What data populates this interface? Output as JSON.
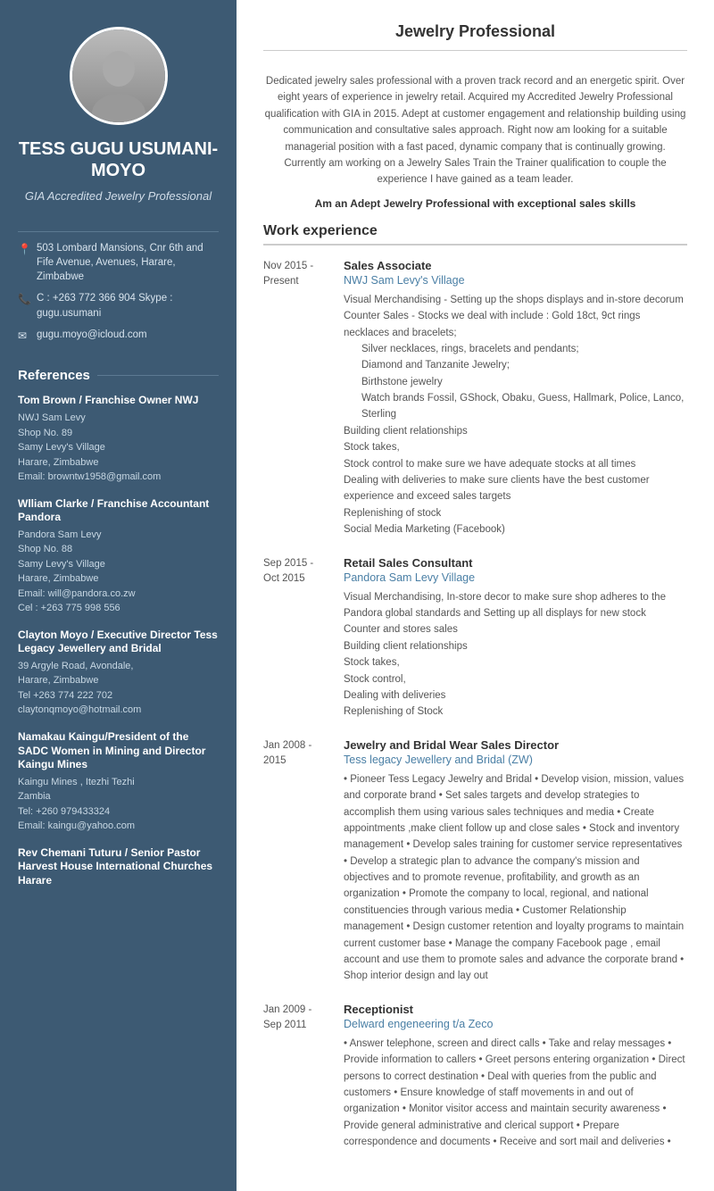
{
  "sidebar": {
    "name": "TESS GUGU USUMANI-MOYO",
    "title": "GIA Accredited Jewelry Professional",
    "contact": {
      "address": "503 Lombard Mansions, Cnr 6th and Fife Avenue, Avenues, Harare, Zimbabwe",
      "phone": "C : +263 772 366 904 Skype : gugu.usumani",
      "email": "gugu.moyo@icloud.com"
    },
    "references_title": "References",
    "references": [
      {
        "name": "Tom Brown / Franchise Owner NWJ",
        "details": [
          "NWJ Sam Levy",
          "Shop No. 89",
          "Samy Levy's Village",
          "Harare, Zimbabwe",
          "Email: browntw1958@gmail.com"
        ]
      },
      {
        "name": "Wlliam Clarke / Franchise Accountant Pandora",
        "details": [
          "Pandora Sam Levy",
          "Shop No. 88",
          "Samy Levy's Village",
          "Harare, Zimbabwe",
          "Email: will@pandora.co.zw",
          "Cel : +263 775 998 556"
        ]
      },
      {
        "name": "Clayton Moyo / Executive Director Tess Legacy Jewellery and Bridal",
        "details": [
          "39 Argyle Road, Avondale,",
          "Harare, Zimbabwe",
          "Tel +263 774 222 702",
          "claytonqmoyo@hotmail.com"
        ]
      },
      {
        "name": "Namakau Kaingu/President of the SADC Women in Mining and Director Kaingu Mines",
        "details": [
          "Kaingu Mines , Itezhi Tezhi",
          "Zambia",
          "Tel: +260 979433324",
          "Email: kaingu@yahoo.com"
        ]
      },
      {
        "name": "Rev Chemani Tuturu / Senior Pastor Harvest House International Churches Harare",
        "details": []
      }
    ]
  },
  "main": {
    "profession_title": "Jewelry Professional",
    "summary": "Dedicated jewelry sales professional with a proven track record and an energetic spirit. Over eight years of experience in jewelry retail. Acquired my Accredited Jewelry Professional qualification with GIA in 2015. Adept at customer engagement and relationship building using communication and consultative sales approach. Right now am looking for a suitable managerial position with a fast paced, dynamic company that is continually growing. Currently am working on a Jewelry Sales Train the Trainer qualification to couple the experience I have gained as a team leader.",
    "summary_bold": "Am an Adept Jewelry Professional with exceptional sales skills",
    "work_experience_title": "Work experience",
    "jobs": [
      {
        "date_start": "Nov 2015 -",
        "date_end": "Present",
        "title": "Sales Associate",
        "company": "NWJ Sam Levy's Village",
        "description": "Visual Merchandising - Setting up the shops displays and in-store decorum\nCounter Sales - Stocks we deal with include : Gold 18ct, 9ct rings necklaces and bracelets;\n    Silver necklaces, rings, bracelets and pendants;\n    Diamond and Tanzanite Jewelry;\n    Birthstone jewelry\n    Watch brands Fossil, GShock, Obaku, Guess, Hallmark, Police, Lanco, Sterling\nBuilding client relationships\nStock takes,\nStock control to make sure we have adequate stocks at all times\nDealing with deliveries to make sure clients have the best customer experience and exceed sales targets\nReplenishing of stock\nSocial Media Marketing (Facebook)"
      },
      {
        "date_start": "Sep 2015 -",
        "date_end": "Oct 2015",
        "title": "Retail Sales Consultant",
        "company": "Pandora Sam Levy Village",
        "description": "Visual Merchandising, In-store decor to make sure shop adheres to the Pandora global standards and Setting up all displays for new stock\nCounter and stores sales\nBuilding client relationships\nStock takes,\nStock control,\nDealing with deliveries\nReplenishing of Stock"
      },
      {
        "date_start": "Jan 2008 -",
        "date_end": "2015",
        "title": "Jewelry and Bridal Wear Sales Director",
        "company": "Tess legacy Jewellery and Bridal (ZW)",
        "description": "• Pioneer Tess Legacy Jewelry and Bridal • Develop vision, mission, values and corporate brand • Set sales targets and develop strategies to accomplish them using various sales techniques and media • Create appointments ,make client follow up and close sales • Stock and inventory management • Develop sales training for customer service representatives • Develop a strategic plan to advance the company's mission and objectives and to promote revenue, profitability, and growth as an organization • Promote the company to local, regional, and national constituencies through various media • Customer Relationship management • Design customer retention and loyalty programs to maintain current customer base • Manage the company Facebook page , email account and use them to promote sales and advance the corporate brand • Shop interior design and lay out"
      },
      {
        "date_start": "Jan 2009 -",
        "date_end": "Sep 2011",
        "title": "Receptionist",
        "company": "Delward engeneering t/a Zeco",
        "description": "• Answer telephone, screen and direct calls • Take and relay messages • Provide information to callers • Greet persons entering organization • Direct persons to correct destination • Deal with queries from the public and customers • Ensure knowledge of staff movements in and out of organization • Monitor visitor access and maintain security awareness • Provide general administrative and clerical support • Prepare correspondence and documents • Receive and sort mail and deliveries •"
      }
    ]
  }
}
